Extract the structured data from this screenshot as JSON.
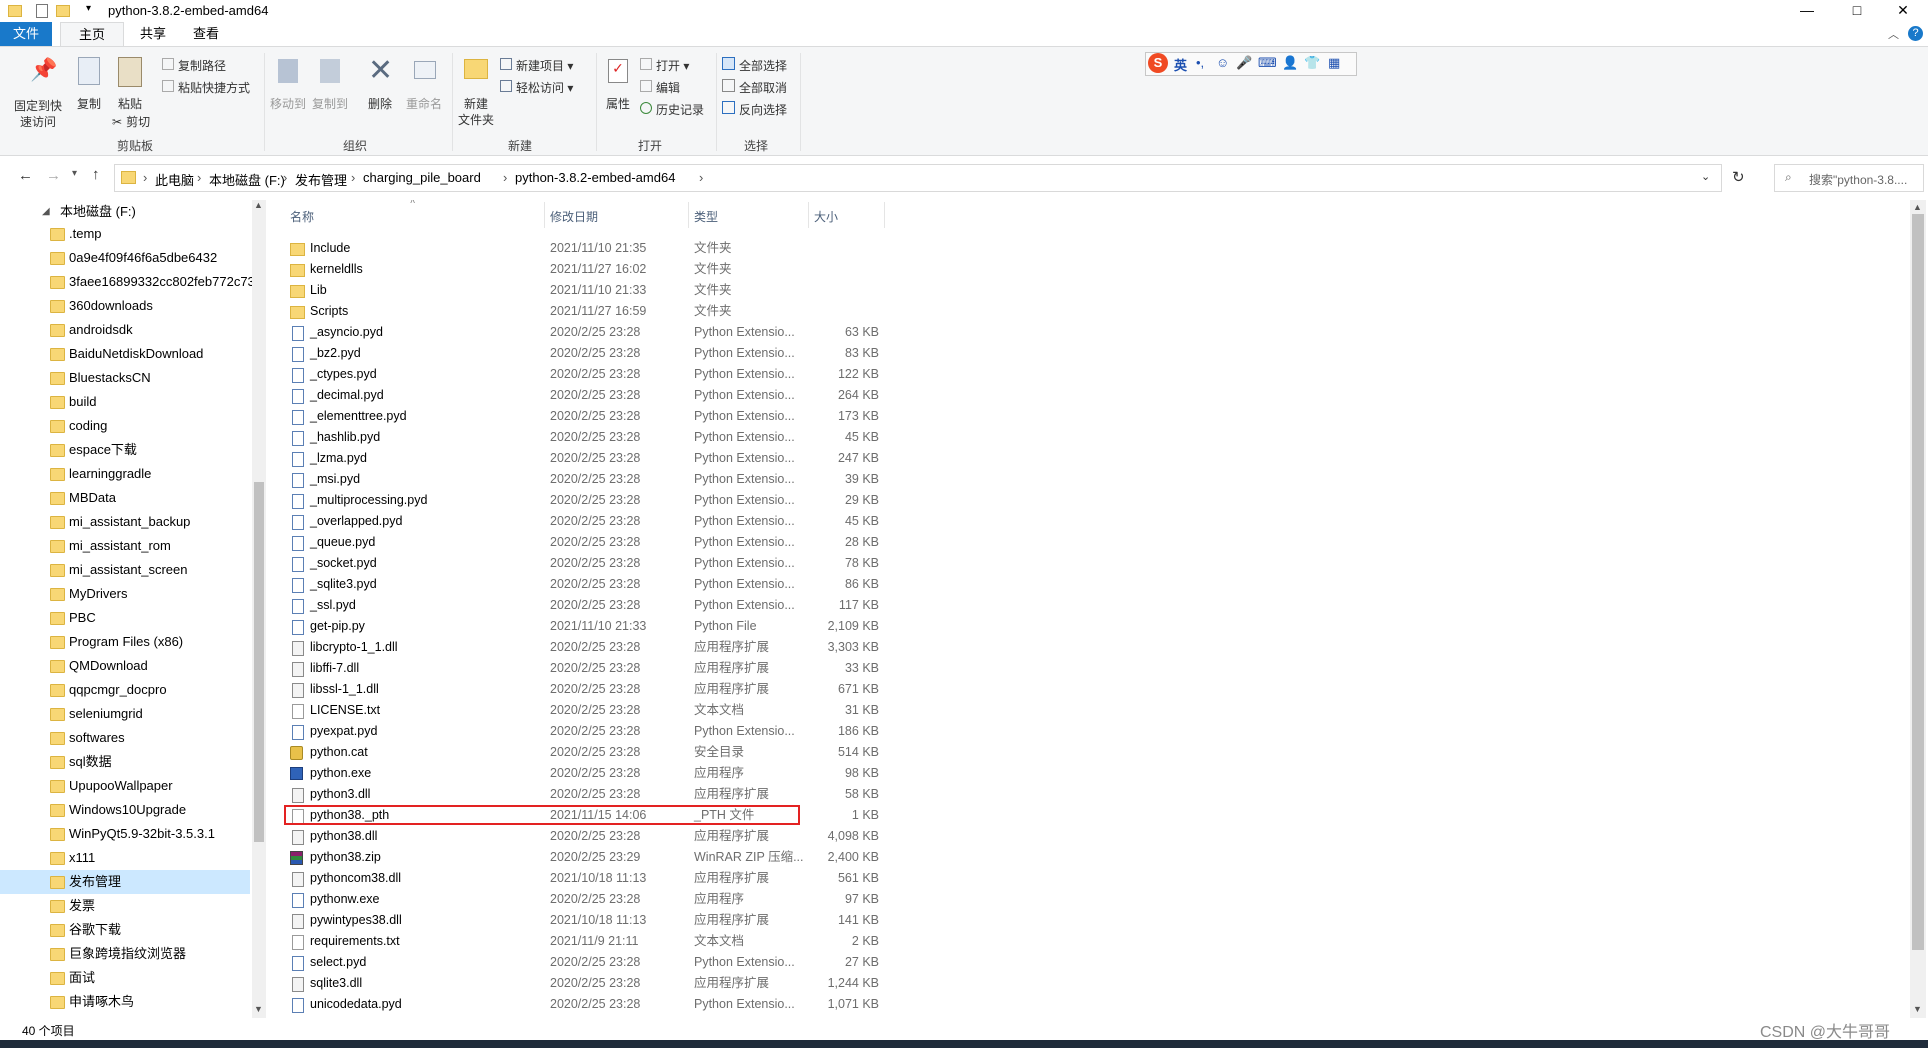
{
  "window": {
    "title": "python-3.8.2-embed-amd64",
    "controls": {
      "minimize": "—",
      "maximize": "□",
      "close": "✕"
    }
  },
  "ribbon_tabs": [
    "文件",
    "主页",
    "共享",
    "查看"
  ],
  "ribbon": {
    "pin": "固定到快\n速访问",
    "pin_l1": "固定到快",
    "pin_l2": "速访问",
    "copy": "复制",
    "paste": "粘贴",
    "copy_path": "复制路径",
    "paste_shortcut": "粘贴快捷方式",
    "cut": "剪切",
    "group_clipboard": "剪贴板",
    "move_to": "移动到",
    "copy_to": "复制到",
    "delete": "删除",
    "rename": "重命名",
    "group_organize": "组织",
    "new_folder_l1": "新建",
    "new_folder_l2": "文件夹",
    "new_item": "新建项目",
    "easy_access": "轻松访问",
    "group_new": "新建",
    "properties": "属性",
    "open": "打开",
    "edit": "编辑",
    "history": "历史记录",
    "group_open": "打开",
    "select_all": "全部选择",
    "select_none": "全部取消",
    "invert_selection": "反向选择",
    "group_select": "选择"
  },
  "ime_bar": {
    "lang": "英"
  },
  "address": {
    "crumbs": [
      "此电脑",
      "本地磁盘 (F:)",
      "发布管理",
      "charging_pile_board",
      "python-3.8.2-embed-amd64"
    ],
    "search_placeholder": "搜索\"python-3.8...."
  },
  "nav": {
    "root": "本地磁盘 (F:)",
    "items": [
      ".temp",
      "0a9e4f09f46f6a5dbe6432",
      "3faee16899332cc802feb772c73",
      "360downloads",
      "androidsdk",
      "BaiduNetdiskDownload",
      "BluestacksCN",
      "build",
      "coding",
      "espace下载",
      "learninggradle",
      "MBData",
      "mi_assistant_backup",
      "mi_assistant_rom",
      "mi_assistant_screen",
      "MyDrivers",
      "PBC",
      "Program Files (x86)",
      "QMDownload",
      "qqpcmgr_docpro",
      "seleniumgrid",
      "softwares",
      "sql数据",
      "UpupooWallpaper",
      "Windows10Upgrade",
      "WinPyQt5.9-32bit-3.5.3.1",
      "x111",
      "发布管理",
      "发票",
      "谷歌下载",
      "巨象跨境指纹浏览器",
      "面试",
      "申请啄木鸟"
    ],
    "selected": "发布管理"
  },
  "columns": {
    "name": "名称",
    "date": "修改日期",
    "type": "类型",
    "size": "大小"
  },
  "files": [
    {
      "name": "Include",
      "date": "2021/11/10 21:35",
      "type": "文件夹",
      "size": "",
      "icon": "folder"
    },
    {
      "name": "kerneldlls",
      "date": "2021/11/27 16:02",
      "type": "文件夹",
      "size": "",
      "icon": "folder"
    },
    {
      "name": "Lib",
      "date": "2021/11/10 21:33",
      "type": "文件夹",
      "size": "",
      "icon": "folder"
    },
    {
      "name": "Scripts",
      "date": "2021/11/27 16:59",
      "type": "文件夹",
      "size": "",
      "icon": "folder"
    },
    {
      "name": "_asyncio.pyd",
      "date": "2020/2/25 23:28",
      "type": "Python Extensio...",
      "size": "63 KB",
      "icon": "pyd"
    },
    {
      "name": "_bz2.pyd",
      "date": "2020/2/25 23:28",
      "type": "Python Extensio...",
      "size": "83 KB",
      "icon": "pyd"
    },
    {
      "name": "_ctypes.pyd",
      "date": "2020/2/25 23:28",
      "type": "Python Extensio...",
      "size": "122 KB",
      "icon": "pyd"
    },
    {
      "name": "_decimal.pyd",
      "date": "2020/2/25 23:28",
      "type": "Python Extensio...",
      "size": "264 KB",
      "icon": "pyd"
    },
    {
      "name": "_elementtree.pyd",
      "date": "2020/2/25 23:28",
      "type": "Python Extensio...",
      "size": "173 KB",
      "icon": "pyd"
    },
    {
      "name": "_hashlib.pyd",
      "date": "2020/2/25 23:28",
      "type": "Python Extensio...",
      "size": "45 KB",
      "icon": "pyd"
    },
    {
      "name": "_lzma.pyd",
      "date": "2020/2/25 23:28",
      "type": "Python Extensio...",
      "size": "247 KB",
      "icon": "pyd"
    },
    {
      "name": "_msi.pyd",
      "date": "2020/2/25 23:28",
      "type": "Python Extensio...",
      "size": "39 KB",
      "icon": "pyd"
    },
    {
      "name": "_multiprocessing.pyd",
      "date": "2020/2/25 23:28",
      "type": "Python Extensio...",
      "size": "29 KB",
      "icon": "pyd"
    },
    {
      "name": "_overlapped.pyd",
      "date": "2020/2/25 23:28",
      "type": "Python Extensio...",
      "size": "45 KB",
      "icon": "pyd"
    },
    {
      "name": "_queue.pyd",
      "date": "2020/2/25 23:28",
      "type": "Python Extensio...",
      "size": "28 KB",
      "icon": "pyd"
    },
    {
      "name": "_socket.pyd",
      "date": "2020/2/25 23:28",
      "type": "Python Extensio...",
      "size": "78 KB",
      "icon": "pyd"
    },
    {
      "name": "_sqlite3.pyd",
      "date": "2020/2/25 23:28",
      "type": "Python Extensio...",
      "size": "86 KB",
      "icon": "pyd"
    },
    {
      "name": "_ssl.pyd",
      "date": "2020/2/25 23:28",
      "type": "Python Extensio...",
      "size": "117 KB",
      "icon": "pyd"
    },
    {
      "name": "get-pip.py",
      "date": "2021/11/10 21:33",
      "type": "Python File",
      "size": "2,109 KB",
      "icon": "pyd"
    },
    {
      "name": "libcrypto-1_1.dll",
      "date": "2020/2/25 23:28",
      "type": "应用程序扩展",
      "size": "3,303 KB",
      "icon": "dll"
    },
    {
      "name": "libffi-7.dll",
      "date": "2020/2/25 23:28",
      "type": "应用程序扩展",
      "size": "33 KB",
      "icon": "dll"
    },
    {
      "name": "libssl-1_1.dll",
      "date": "2020/2/25 23:28",
      "type": "应用程序扩展",
      "size": "671 KB",
      "icon": "dll"
    },
    {
      "name": "LICENSE.txt",
      "date": "2020/2/25 23:28",
      "type": "文本文档",
      "size": "31 KB",
      "icon": "file"
    },
    {
      "name": "pyexpat.pyd",
      "date": "2020/2/25 23:28",
      "type": "Python Extensio...",
      "size": "186 KB",
      "icon": "pyd"
    },
    {
      "name": "python.cat",
      "date": "2020/2/25 23:28",
      "type": "安全目录",
      "size": "514 KB",
      "icon": "cat"
    },
    {
      "name": "python.exe",
      "date": "2020/2/25 23:28",
      "type": "应用程序",
      "size": "98 KB",
      "icon": "exe"
    },
    {
      "name": "python3.dll",
      "date": "2020/2/25 23:28",
      "type": "应用程序扩展",
      "size": "58 KB",
      "icon": "dll"
    },
    {
      "name": "python38._pth",
      "date": "2021/11/15 14:06",
      "type": "_PTH 文件",
      "size": "1 KB",
      "icon": "file"
    },
    {
      "name": "python38.dll",
      "date": "2020/2/25 23:28",
      "type": "应用程序扩展",
      "size": "4,098 KB",
      "icon": "dll"
    },
    {
      "name": "python38.zip",
      "date": "2020/2/25 23:29",
      "type": "WinRAR ZIP 压缩...",
      "size": "2,400 KB",
      "icon": "zip"
    },
    {
      "name": "pythoncom38.dll",
      "date": "2021/10/18 11:13",
      "type": "应用程序扩展",
      "size": "561 KB",
      "icon": "dll"
    },
    {
      "name": "pythonw.exe",
      "date": "2020/2/25 23:28",
      "type": "应用程序",
      "size": "97 KB",
      "icon": "pyd"
    },
    {
      "name": "pywintypes38.dll",
      "date": "2021/10/18 11:13",
      "type": "应用程序扩展",
      "size": "141 KB",
      "icon": "dll"
    },
    {
      "name": "requirements.txt",
      "date": "2021/11/9 21:11",
      "type": "文本文档",
      "size": "2 KB",
      "icon": "file"
    },
    {
      "name": "select.pyd",
      "date": "2020/2/25 23:28",
      "type": "Python Extensio...",
      "size": "27 KB",
      "icon": "pyd"
    },
    {
      "name": "sqlite3.dll",
      "date": "2020/2/25 23:28",
      "type": "应用程序扩展",
      "size": "1,244 KB",
      "icon": "dll"
    },
    {
      "name": "unicodedata.pyd",
      "date": "2020/2/25 23:28",
      "type": "Python Extensio...",
      "size": "1,071 KB",
      "icon": "pyd"
    }
  ],
  "highlighted_file": "python38._pth",
  "status": {
    "count": "40 个项目"
  },
  "watermark": "CSDN @大牛哥哥",
  "colors": {
    "accent": "#1979ca",
    "selection": "#cce8ff",
    "highlight_box": "#e32222"
  }
}
